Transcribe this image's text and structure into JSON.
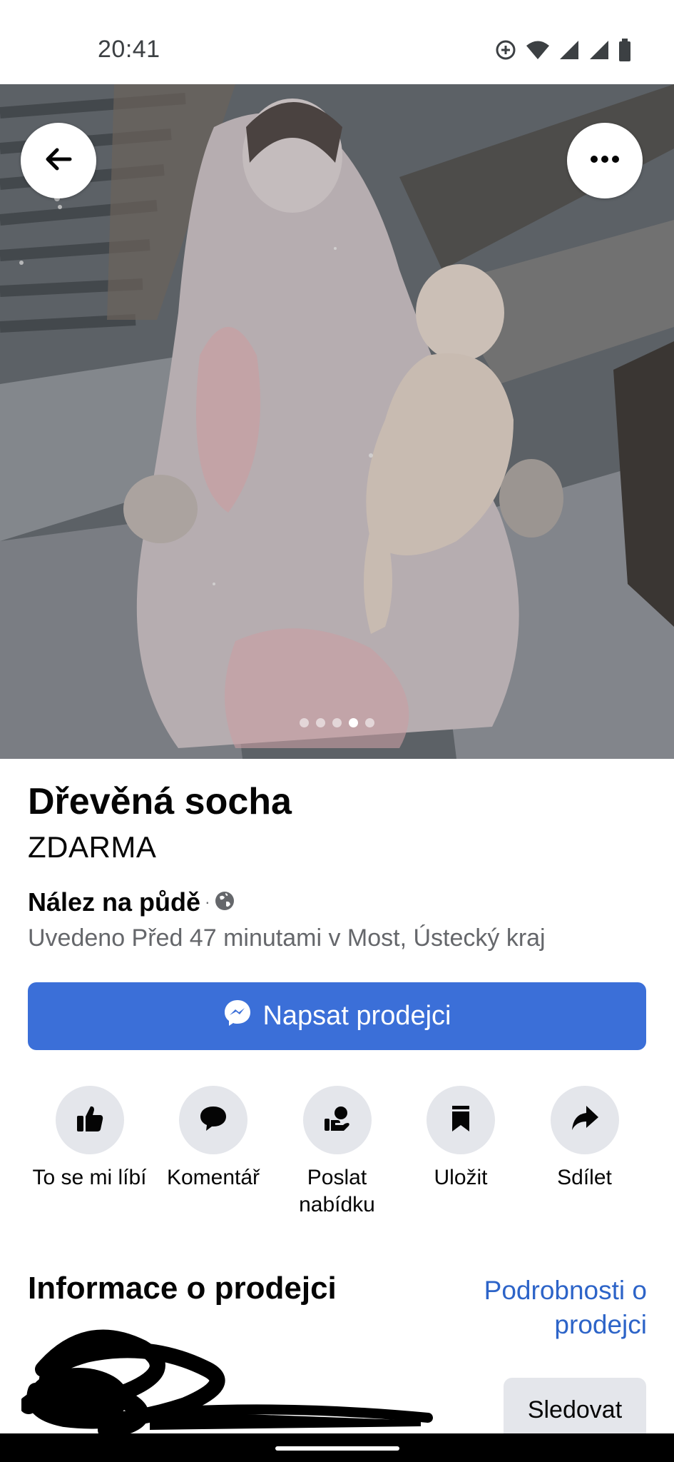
{
  "status_bar": {
    "time": "20:41",
    "icons": [
      "data-saver-icon",
      "wifi-icon",
      "signal-icon",
      "signal-icon",
      "battery-icon"
    ]
  },
  "photo": {
    "slide_count": 5,
    "active_slide": 4
  },
  "listing": {
    "title": "Dřevěná socha",
    "price": "ZDARMA",
    "subtitle": "Nález na půdě",
    "separator": "·",
    "meta": "Uvedeno Před 47 minutami v Most, Ústecký kraj"
  },
  "message_button": {
    "label": "Napsat prodejci",
    "color": "#3b6fd8"
  },
  "actions": [
    {
      "label": "To se mi líbí",
      "icon": "like-icon"
    },
    {
      "label": "Komentář",
      "icon": "comment-icon"
    },
    {
      "label": "Poslat nabídku",
      "icon": "offer-icon"
    },
    {
      "label": "Uložit",
      "icon": "bookmark-icon"
    },
    {
      "label": "Sdílet",
      "icon": "share-icon"
    }
  ],
  "seller": {
    "section_title": "Informace o prodejci",
    "details_link": "Podrobnosti o prodejci",
    "follow_label": "Sledovat"
  },
  "colors": {
    "accent": "#3b6fd8",
    "link": "#2d64c8",
    "secondary_text": "#65676b",
    "button_gray": "#e4e6eb"
  }
}
